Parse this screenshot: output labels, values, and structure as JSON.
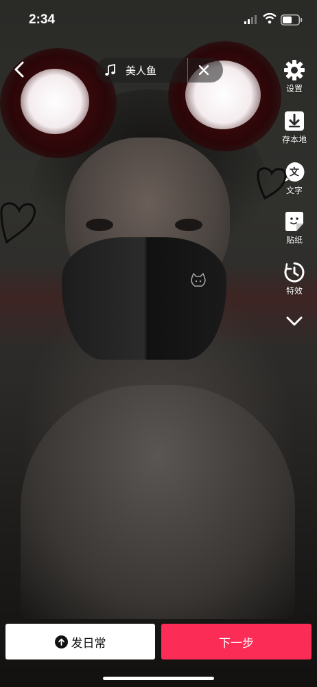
{
  "status_bar": {
    "time": "2:34"
  },
  "music": {
    "title": "美人鱼"
  },
  "sidebar": {
    "items": [
      {
        "label": "设置",
        "icon": "gear-icon"
      },
      {
        "label": "存本地",
        "icon": "download-icon"
      },
      {
        "label": "文字",
        "icon": "text-icon"
      },
      {
        "label": "贴纸",
        "icon": "sticker-icon"
      },
      {
        "label": "特效",
        "icon": "effects-timer-icon"
      }
    ],
    "more_icon": "chevron-down-icon"
  },
  "bottom": {
    "daily_label": "发日常",
    "next_label": "下一步"
  },
  "colors": {
    "accent": "#fb2c55",
    "ear_inner": "#ffffff",
    "ear_outer": "#4a0e12"
  }
}
